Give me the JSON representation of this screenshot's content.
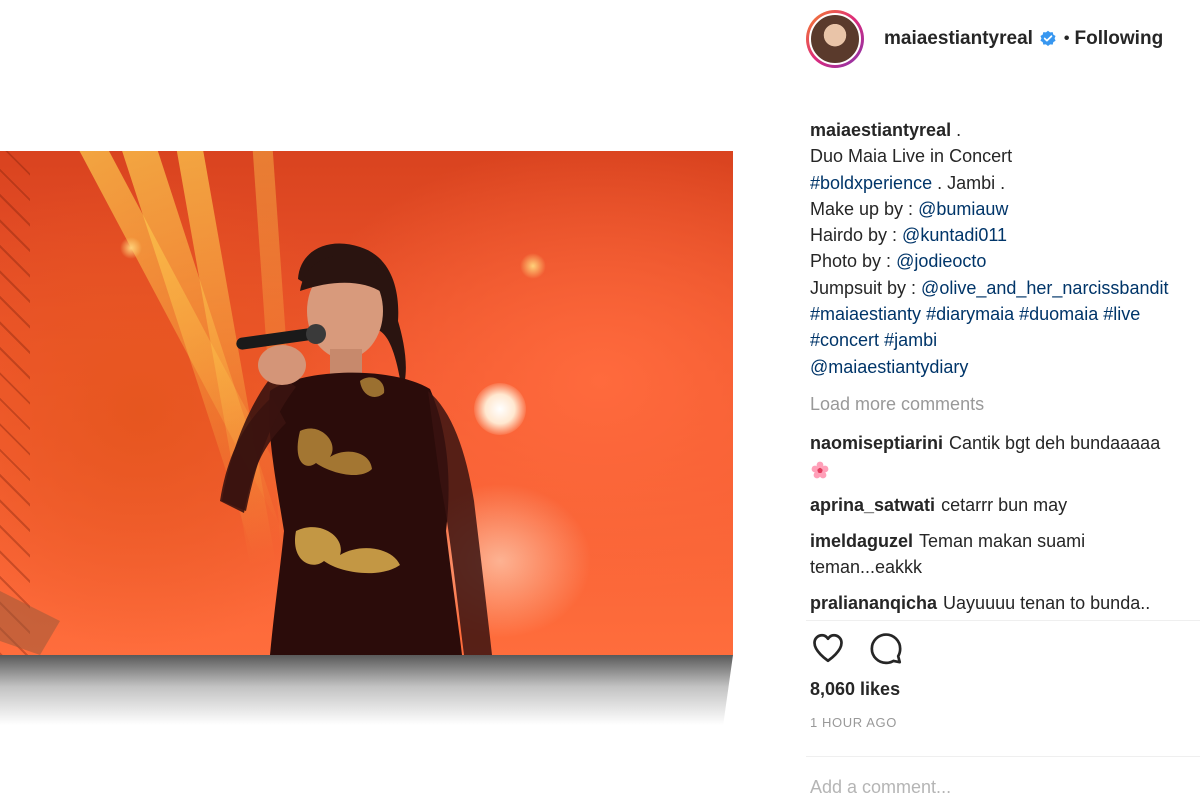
{
  "post": {
    "author": "maiaestiantyreal",
    "verified": true,
    "follow_separator": "•",
    "follow_status": "Following"
  },
  "caption": {
    "author": "maiaestiantyreal",
    "lines": [
      {
        "parts": [
          {
            "t": "",
            "tag": false
          },
          {
            "t": " .",
            "tag": false
          }
        ]
      },
      {
        "parts": [
          {
            "t": "Duo Maia Live in Concert",
            "tag": false
          }
        ]
      },
      {
        "parts": [
          {
            "t": "#boldxperience",
            "tag": true
          },
          {
            "t": " . Jambi .",
            "tag": false
          }
        ]
      },
      {
        "parts": [
          {
            "t": "Make up by : ",
            "tag": false
          },
          {
            "t": "@bumiauw",
            "tag": true
          }
        ]
      },
      {
        "parts": [
          {
            "t": "Hairdo by : ",
            "tag": false
          },
          {
            "t": "@kuntadi011",
            "tag": true
          }
        ]
      },
      {
        "parts": [
          {
            "t": "Photo by : ",
            "tag": false
          },
          {
            "t": "@jodieocto",
            "tag": true
          }
        ]
      },
      {
        "parts": [
          {
            "t": "Jumpsuit by : ",
            "tag": false
          },
          {
            "t": "@olive_and_her_narcissbandit",
            "tag": true
          }
        ]
      },
      {
        "parts": [
          {
            "t": "#maiaestianty",
            "tag": true
          },
          {
            "t": " ",
            "tag": false
          },
          {
            "t": "#diarymaia",
            "tag": true
          },
          {
            "t": " ",
            "tag": false
          },
          {
            "t": "#duomaia",
            "tag": true
          },
          {
            "t": " ",
            "tag": false
          },
          {
            "t": "#live",
            "tag": true
          }
        ]
      },
      {
        "parts": [
          {
            "t": "#concert",
            "tag": true
          },
          {
            "t": " ",
            "tag": false
          },
          {
            "t": "#jambi",
            "tag": true
          }
        ]
      },
      {
        "parts": [
          {
            "t": "@maiaestiantydiary",
            "tag": true
          }
        ]
      }
    ]
  },
  "load_more_label": "Load more comments",
  "comments": [
    {
      "user": "naomiseptiarini",
      "text": "Cantik bgt deh bundaaaaa",
      "emoji": "flower"
    },
    {
      "user": "aprina_satwati",
      "text": "cetarrr bun may"
    },
    {
      "user": "imeldaguzel",
      "text": "Teman makan suami",
      "continued": "teman...eakkk"
    },
    {
      "user": "praliananqicha",
      "text": "Uayuuuu tenan to bunda.."
    }
  ],
  "likes_label": "8,060 likes",
  "timestamp": "1 HOUR AGO",
  "comment_placeholder": "Add a comment...",
  "icons": {
    "verified": "verified-badge-icon",
    "like": "heart-icon",
    "comment": "comment-bubble-icon"
  },
  "colors": {
    "text": "#262626",
    "muted": "#999999",
    "link": "#003569",
    "verified": "#3897f0",
    "photo_primary": "#f0582e"
  }
}
